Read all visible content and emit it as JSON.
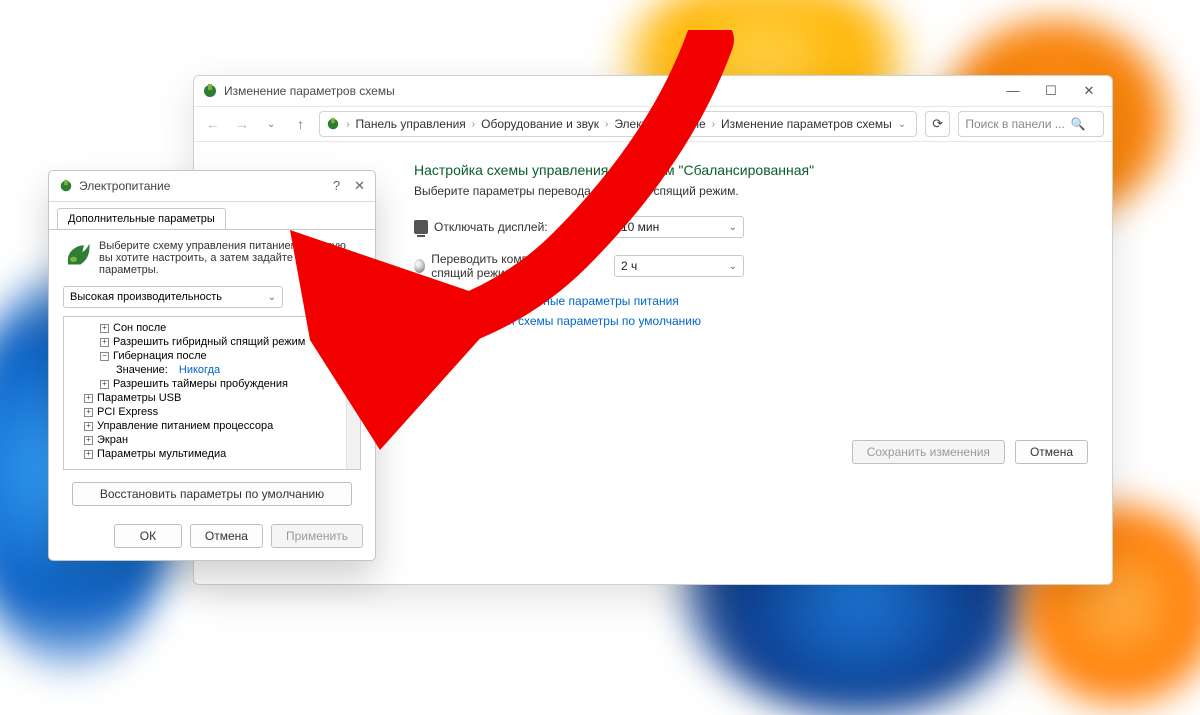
{
  "main_window": {
    "title": "Изменение параметров схемы",
    "breadcrumb": [
      "Панель управления",
      "Оборудование и звук",
      "Электропитание",
      "Изменение параметров схемы"
    ],
    "search_placeholder": "Поиск в панели ...",
    "heading": "Настройка схемы управления питанием \"Сбалансированная\"",
    "subheading": "Выберите параметры перевода дисплея в спящий режим.",
    "row_display_label": "Отключать дисплей:",
    "row_display_value": "10 мин",
    "row_sleep_label": "Переводить компьютер в спящий режим:",
    "row_sleep_value": "2 ч",
    "link_advanced": "Изменить дополнительные параметры питания",
    "link_restore": "Восстановить для схемы параметры по умолчанию",
    "btn_save": "Сохранить изменения",
    "btn_cancel": "Отмена"
  },
  "dialog": {
    "title": "Электропитание",
    "tab": "Дополнительные параметры",
    "hint": "Выберите схему управления питанием, которую вы хотите настроить, а затем задайте нужные параметры.",
    "scheme": "Высокая производительность",
    "tree": {
      "sleep_after": "Сон после",
      "hybrid_sleep": "Разрешить гибридный спящий режим",
      "hibernate_after": "Гибернация после",
      "value_label": "Значение:",
      "value": "Никогда",
      "wake_timers": "Разрешить таймеры пробуждения",
      "usb": "Параметры USB",
      "pci": "PCI Express",
      "cpu": "Управление питанием процессора",
      "screen": "Экран",
      "multimedia": "Параметры мультимедиа"
    },
    "btn_restore": "Восстановить параметры по умолчанию",
    "btn_ok": "ОК",
    "btn_cancel": "Отмена",
    "btn_apply": "Применить"
  }
}
